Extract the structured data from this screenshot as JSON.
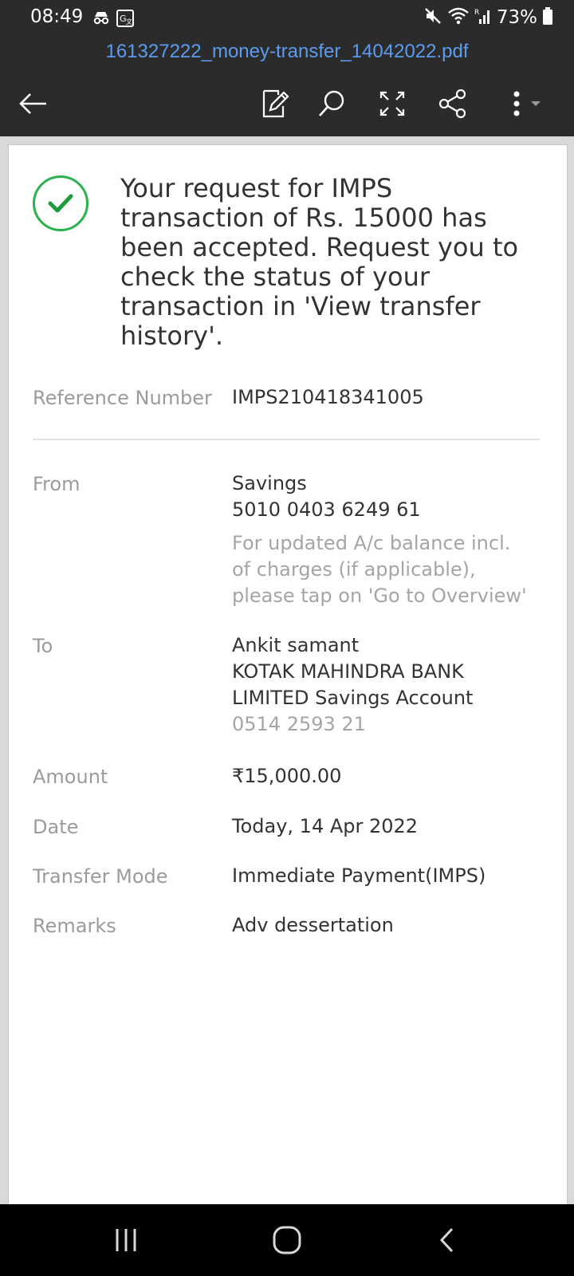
{
  "status_bar": {
    "time": "08:49",
    "battery_percent": "73%",
    "icons": [
      "incognito-icon",
      "translate-icon",
      "mute-icon",
      "wifi-icon",
      "signal-icon",
      "battery-icon"
    ]
  },
  "document": {
    "filename": "161327222_money-transfer_14042022.pdf"
  },
  "toolbar": {
    "icons": [
      "back-arrow-icon",
      "edit-icon",
      "search-icon",
      "fullscreen-icon",
      "share-icon",
      "more-icon"
    ]
  },
  "receipt": {
    "message": "Your request for IMPS transaction of Rs. 15000 has been accepted. Request you to check the status of your transaction in 'View transfer history'.",
    "reference": {
      "label": "Reference Number",
      "value": "IMPS210418341005"
    },
    "from": {
      "label": "From",
      "account_type": "Savings",
      "account_number": "5010 0403 6249 61",
      "note_line1": "For updated A/c balance incl.",
      "note_line2": "of charges (if applicable),",
      "note_line3": "please tap on 'Go to Overview'"
    },
    "to": {
      "label": "To",
      "name": "Ankit samant",
      "bank_line1": "KOTAK MAHINDRA BANK",
      "bank_line2": "LIMITED Savings Account",
      "account_number": "0514 2593 21"
    },
    "amount": {
      "label": "Amount",
      "value": "₹15,000.00"
    },
    "date": {
      "label": "Date",
      "value": "Today, 14 Apr 2022"
    },
    "mode": {
      "label": "Transfer Mode",
      "value": "Immediate Payment(IMPS)"
    },
    "remarks": {
      "label": "Remarks",
      "value": "Adv dessertation"
    }
  },
  "nav_bar": {
    "icons": [
      "recent-apps-icon",
      "home-icon",
      "back-icon"
    ]
  },
  "colors": {
    "accent_link": "#5b9bf0",
    "success_green": "#2bb24c",
    "toolbar_bg": "#2b2b2b"
  }
}
